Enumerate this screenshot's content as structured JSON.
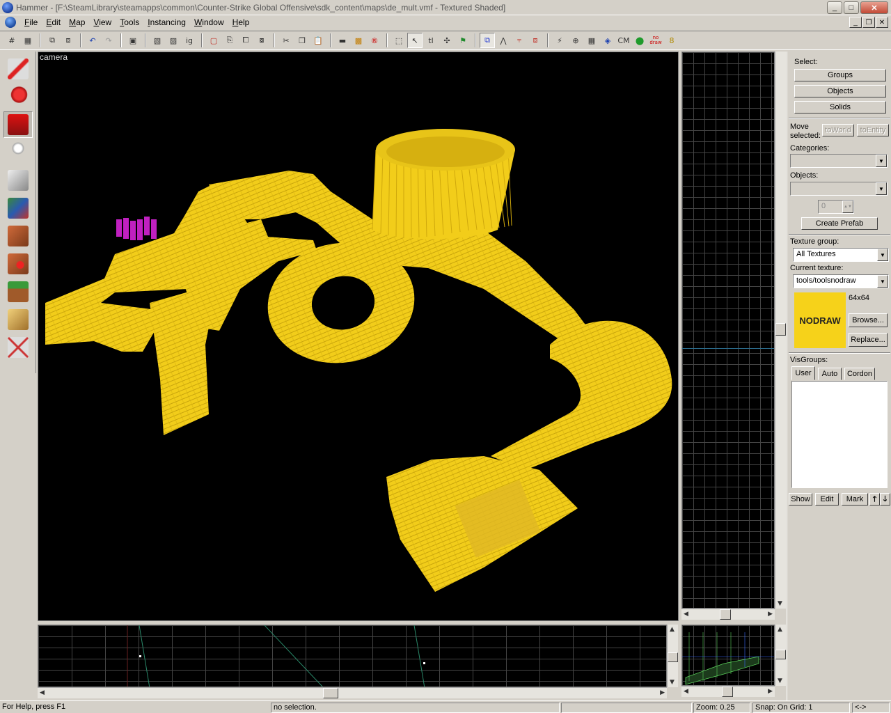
{
  "window": {
    "title": "Hammer - [F:\\SteamLibrary\\steamapps\\common\\Counter-Strike Global Offensive\\sdk_content\\maps\\de_mult.vmf - Textured Shaded]",
    "btn_min": "_",
    "btn_max": "□",
    "btn_close": "✕"
  },
  "menu": {
    "items": [
      "File",
      "Edit",
      "Map",
      "View",
      "Tools",
      "Instancing",
      "Window",
      "Help"
    ],
    "mdi_min": "_",
    "mdi_restore": "❐",
    "mdi_close": "✕"
  },
  "toolbar": {
    "labels": {
      "ig": "ig",
      "tl": "tl",
      "cm": "CM",
      "nodraw": "no draw",
      "eight": "8"
    }
  },
  "viewport": {
    "label": "camera",
    "object_color": "#f2cd1a",
    "accent_magenta": "#c020c0"
  },
  "panel": {
    "select_label": "Select:",
    "select_buttons": [
      "Groups",
      "Objects",
      "Solids"
    ],
    "move_label_1": "Move",
    "move_label_2": "selected:",
    "to_world": "toWorld",
    "to_entity": "toEntity",
    "categories_label": "Categories:",
    "objects_label": "Objects:",
    "spin_value": "0",
    "create_prefab": "Create Prefab",
    "texture_group_label": "Texture group:",
    "texture_group_value": "All Textures",
    "current_texture_label": "Current texture:",
    "current_texture_value": "tools/toolsnodraw",
    "texture_size": "64x64",
    "texture_preview_text": "NODRAW",
    "browse": "Browse...",
    "replace": "Replace...",
    "visgroups_label": "VisGroups:",
    "tabs": [
      "User",
      "Auto",
      "Cordon"
    ],
    "show": "Show",
    "edit": "Edit",
    "mark": "Mark",
    "up": "🡑",
    "down": "🡓"
  },
  "status": {
    "help": "For Help, press F1",
    "selection": "no selection.",
    "zoom": "Zoom: 0.25",
    "snap": "Snap: On Grid: 1",
    "arrows": "<->"
  }
}
